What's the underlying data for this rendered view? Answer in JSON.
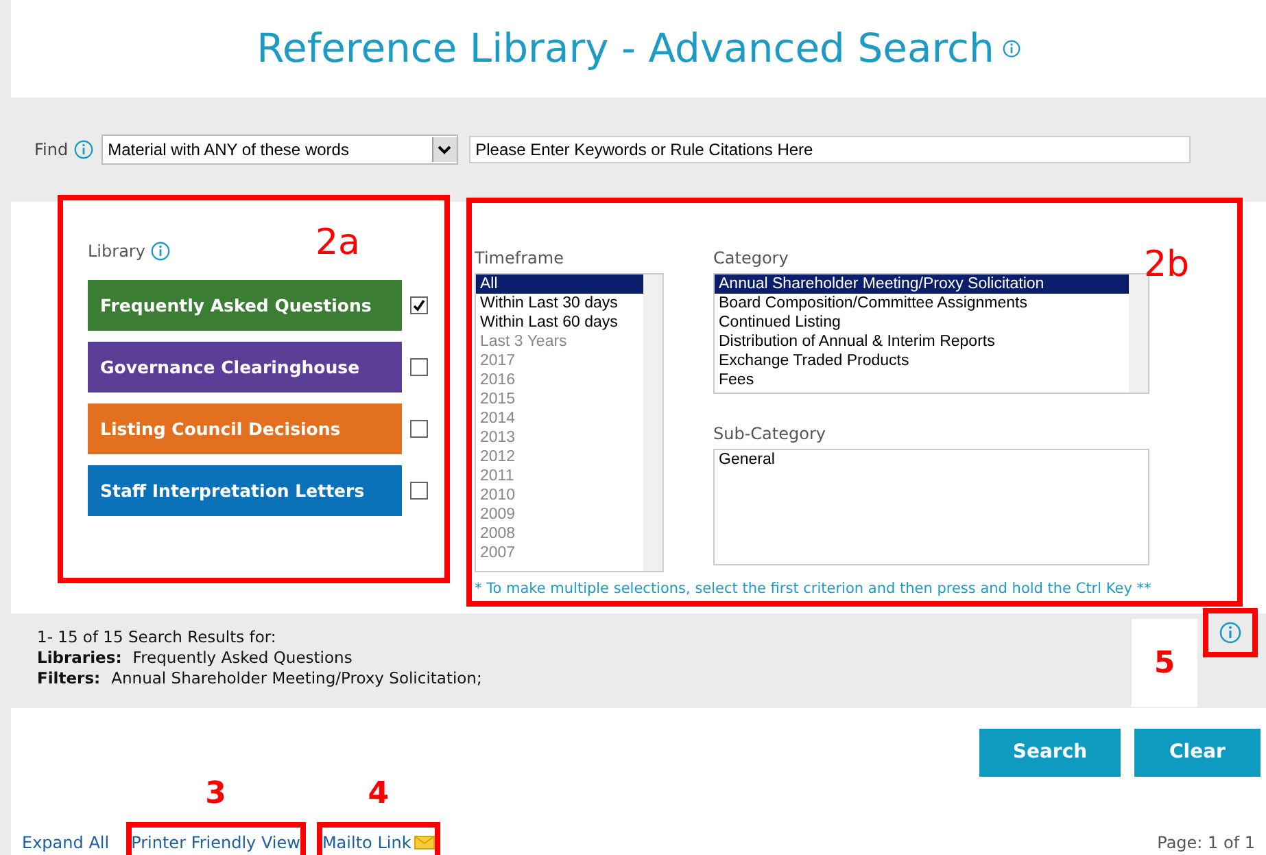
{
  "title": "Reference Library - Advanced Search",
  "find": {
    "label": "Find",
    "mode": "Material with ANY of these words",
    "placeholder": "Please Enter Keywords or Rule Citations Here"
  },
  "library": {
    "label": "Library",
    "annotation": "2a",
    "items": [
      {
        "label": "Frequently Asked Questions",
        "color": "#3b7d33",
        "checked": true
      },
      {
        "label": "Governance Clearinghouse",
        "color": "#5b3f96",
        "checked": false
      },
      {
        "label": "Listing Council Decisions",
        "color": "#e2701f",
        "checked": false
      },
      {
        "label": "Staff Interpretation Letters",
        "color": "#0b72b9",
        "checked": false
      }
    ]
  },
  "filters": {
    "annotation": "2b",
    "timeframe": {
      "label": "Timeframe",
      "options": [
        {
          "label": "All",
          "selected": true,
          "disabled": false
        },
        {
          "label": "Within Last 30 days",
          "selected": false,
          "disabled": false
        },
        {
          "label": "Within Last 60 days",
          "selected": false,
          "disabled": false
        },
        {
          "label": "Last 3 Years",
          "selected": false,
          "disabled": true
        },
        {
          "label": "2017",
          "selected": false,
          "disabled": true
        },
        {
          "label": "2016",
          "selected": false,
          "disabled": true
        },
        {
          "label": "2015",
          "selected": false,
          "disabled": true
        },
        {
          "label": "2014",
          "selected": false,
          "disabled": true
        },
        {
          "label": "2013",
          "selected": false,
          "disabled": true
        },
        {
          "label": "2012",
          "selected": false,
          "disabled": true
        },
        {
          "label": "2011",
          "selected": false,
          "disabled": true
        },
        {
          "label": "2010",
          "selected": false,
          "disabled": true
        },
        {
          "label": "2009",
          "selected": false,
          "disabled": true
        },
        {
          "label": "2008",
          "selected": false,
          "disabled": true
        },
        {
          "label": "2007",
          "selected": false,
          "disabled": true
        }
      ]
    },
    "category": {
      "label": "Category",
      "options": [
        {
          "label": "Annual Shareholder Meeting/Proxy Solicitation",
          "selected": true
        },
        {
          "label": "Board Composition/Committee Assignments",
          "selected": false
        },
        {
          "label": "Continued Listing",
          "selected": false
        },
        {
          "label": "Distribution of Annual & Interim Reports",
          "selected": false
        },
        {
          "label": "Exchange Traded Products",
          "selected": false
        },
        {
          "label": "Fees",
          "selected": false
        }
      ]
    },
    "subcategory": {
      "label": "Sub-Category",
      "options": [
        {
          "label": "General",
          "selected": false
        }
      ]
    },
    "hint": "* To make multiple selections, select the first criterion and then press and hold the Ctrl Key **"
  },
  "results": {
    "summary": "1- 15 of 15 Search Results for:",
    "lines": [
      {
        "label": "Libraries:",
        "value": "Frequently Asked Questions"
      },
      {
        "label": "Filters:",
        "value": "Annual Shareholder Meeting/Proxy Solicitation;"
      }
    ],
    "annotation": "5"
  },
  "buttons": [
    {
      "label": "Search"
    },
    {
      "label": "Clear"
    }
  ],
  "footer": {
    "links": [
      {
        "label": "Expand All",
        "kind": "plain"
      },
      {
        "label": "Printer Friendly View",
        "kind": "plain",
        "annotation": "3"
      },
      {
        "label": "Mailto Link",
        "kind": "mail",
        "annotation": "4"
      }
    ],
    "page": "Page: 1 of 1"
  }
}
